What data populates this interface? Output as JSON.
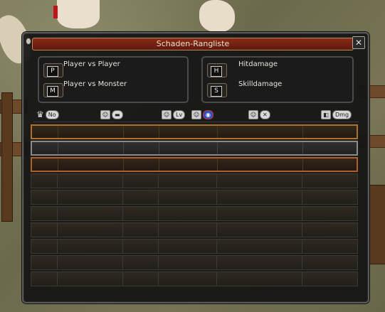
{
  "window": {
    "title": "Schaden-Rangliste",
    "close_label": "✕"
  },
  "mode_options": [
    {
      "key": "P",
      "label": "Player vs Player"
    },
    {
      "key": "M",
      "label": "Player vs Monster"
    }
  ],
  "damage_options": [
    {
      "key": "H",
      "label": "Hitdamage"
    },
    {
      "key": "S",
      "label": "Skilldamage"
    }
  ],
  "columns": [
    {
      "icon": "crown-icon",
      "label": "No"
    },
    {
      "icon": "player-icon",
      "label": "▬"
    },
    {
      "icon": "player-icon",
      "label": "Lv"
    },
    {
      "icon": "empire-flag-icon",
      "label": "◉"
    },
    {
      "icon": "player-icon",
      "label": "✕"
    },
    {
      "icon": "damage-icon",
      "label": "Dmg"
    }
  ],
  "rows": [
    {
      "rank_style": "gold"
    },
    {
      "rank_style": "silver"
    },
    {
      "rank_style": "bronze"
    },
    {
      "rank_style": "normal"
    },
    {
      "rank_style": "normal"
    },
    {
      "rank_style": "normal"
    },
    {
      "rank_style": "normal"
    },
    {
      "rank_style": "normal"
    },
    {
      "rank_style": "normal"
    },
    {
      "rank_style": "normal"
    }
  ],
  "colors": {
    "title_bar": "#7a2412",
    "gold_border": "#b0702a",
    "silver_border": "#8a8a8a",
    "bronze_border": "#b0602a"
  }
}
